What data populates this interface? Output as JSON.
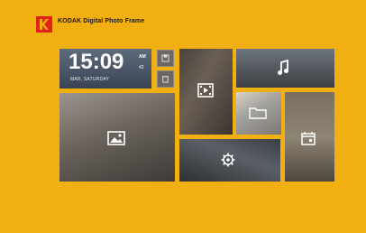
{
  "app": {
    "title": "KODAK Digital Photo Frame"
  },
  "colors": {
    "background": "#f2af12",
    "logo_red": "#e2231a",
    "title_text": "#1a1a1a"
  },
  "clock": {
    "time": "15:09",
    "ampm": "AM",
    "seconds": "42",
    "date": "MAR, SATURDAY"
  },
  "tiles": [
    {
      "name": "photo",
      "icon": "image-icon"
    },
    {
      "name": "video",
      "icon": "video-icon"
    },
    {
      "name": "music",
      "icon": "music-icon"
    },
    {
      "name": "file",
      "icon": "folder-icon"
    },
    {
      "name": "calendar",
      "icon": "calendar-icon"
    },
    {
      "name": "settings",
      "icon": "gear-icon"
    }
  ]
}
